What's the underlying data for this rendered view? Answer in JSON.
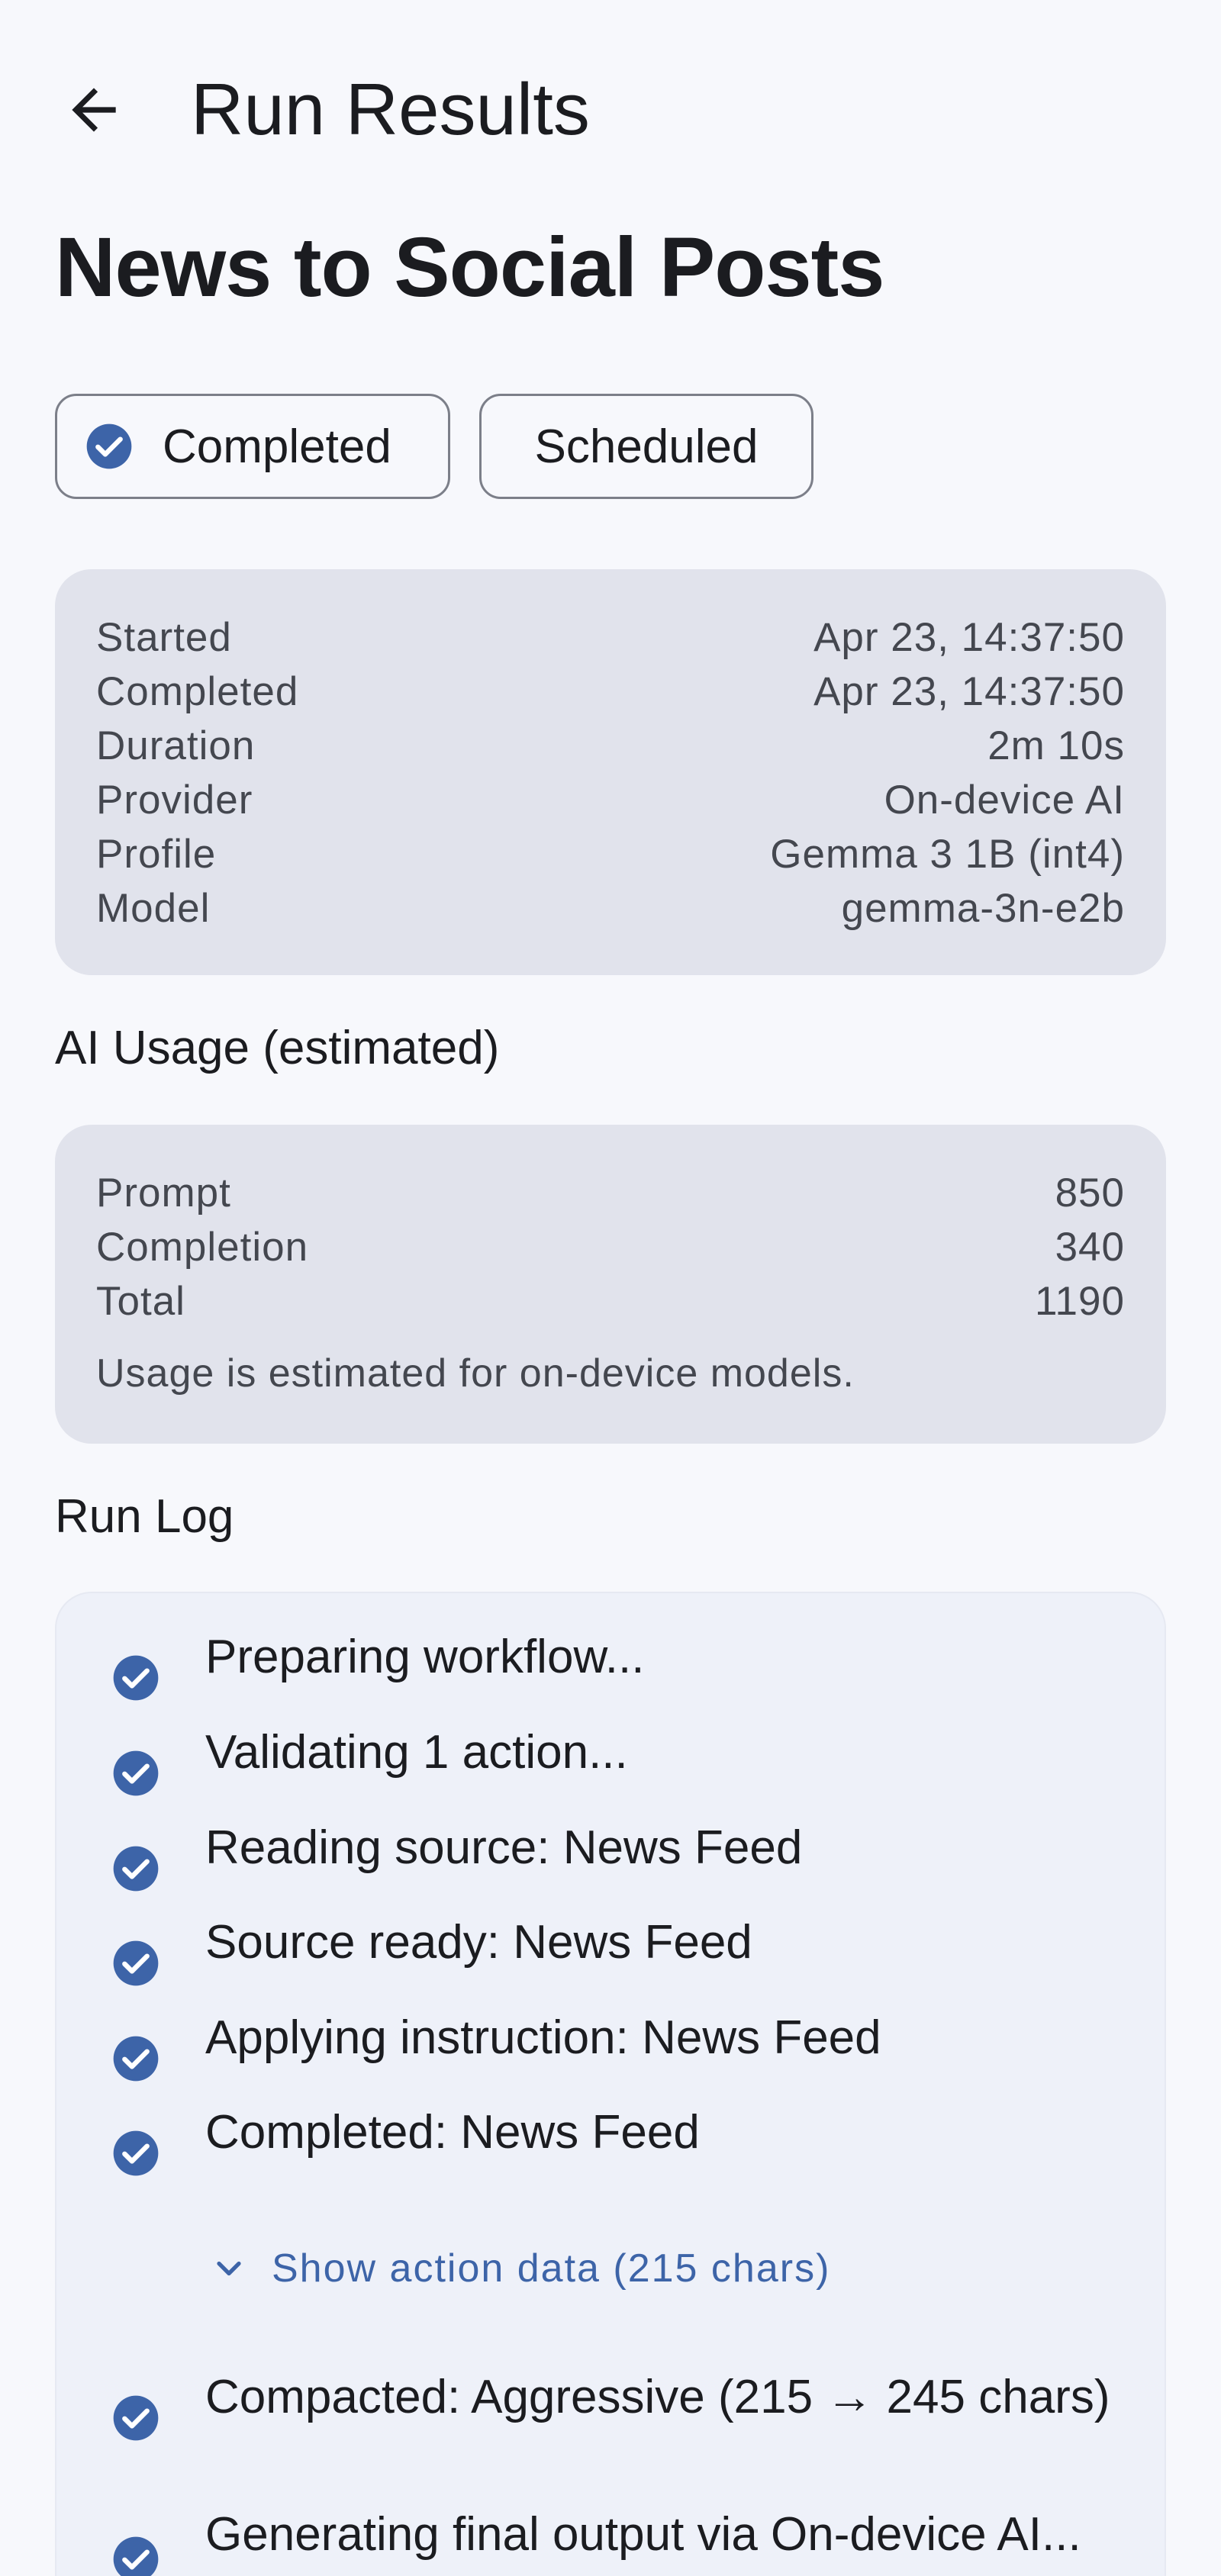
{
  "header": {
    "title": "Run Results",
    "back_icon": "arrow-back-icon"
  },
  "workflow": {
    "name": "News to Social Posts"
  },
  "chips": {
    "status": {
      "label": "Completed",
      "icon": "check-circle-icon",
      "selected": true
    },
    "trigger": {
      "label": "Scheduled"
    }
  },
  "meta": {
    "rows": [
      {
        "label": "Started",
        "value": "Apr 23, 14:37:50"
      },
      {
        "label": "Completed",
        "value": "Apr 23, 14:37:50"
      },
      {
        "label": "Duration",
        "value": "2m 10s"
      },
      {
        "label": "Provider",
        "value": "On-device AI"
      },
      {
        "label": "Profile",
        "value": "Gemma 3 1B (int4)"
      },
      {
        "label": "Model",
        "value": "gemma-3n-e2b"
      }
    ]
  },
  "usage": {
    "heading": "AI Usage (estimated)",
    "rows": [
      {
        "label": "Prompt",
        "value": "850"
      },
      {
        "label": "Completion",
        "value": "340"
      },
      {
        "label": "Total",
        "value": "1190"
      }
    ],
    "note": "Usage is estimated for on-device models."
  },
  "log": {
    "heading": "Run Log",
    "items": [
      {
        "text": "Preparing workflow...",
        "icon": "check-circle-icon"
      },
      {
        "text": "Validating 1 action...",
        "icon": "check-circle-icon"
      },
      {
        "text": "Reading source: News Feed",
        "icon": "check-circle-icon"
      },
      {
        "text": "Source ready: News Feed",
        "icon": "check-circle-icon"
      },
      {
        "text": "Applying instruction: News Feed",
        "icon": "check-circle-icon"
      },
      {
        "text": "Completed: News Feed",
        "icon": "check-circle-icon"
      },
      {
        "text": "Compacted: Aggressive (215 → 245 chars)",
        "icon": "check-circle-icon"
      },
      {
        "text": "Generating final output via On-device AI...",
        "icon": "check-circle-icon"
      }
    ],
    "show_action_data": "Show action data (215 chars)"
  },
  "colors": {
    "accent": "#3d64a8",
    "card_bg": "#e1e3ec",
    "page_bg": "#f7f8fc"
  }
}
